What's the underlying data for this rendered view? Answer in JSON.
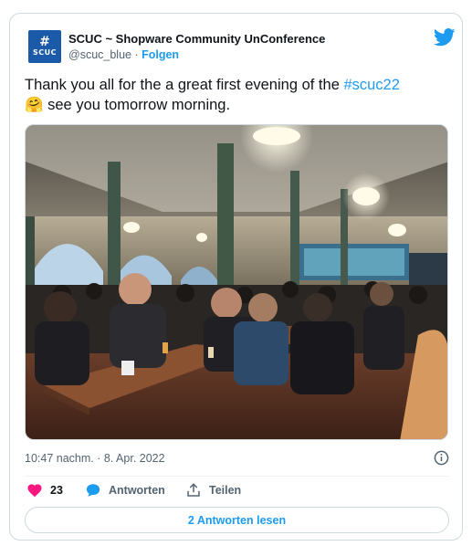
{
  "account": {
    "avatar_symbol": "#",
    "avatar_text": "SCUC",
    "display_name": "SCUC ~ Shopware Community UnConference",
    "handle": "@scuc_blue",
    "separator": " · ",
    "follow_label": "Folgen"
  },
  "tweet": {
    "text_before": "Thank you all for the a great first evening of the ",
    "hashtag": "#scuc22",
    "emoji": "🤗",
    "text_after": " see you tomorrow morning."
  },
  "meta": {
    "timestamp": "10:47 nachm. · 8. Apr. 2022"
  },
  "actions": {
    "like_count": "23",
    "reply_label": "Antworten",
    "share_label": "Teilen"
  },
  "read_replies_label": "2 Antworten lesen",
  "colors": {
    "accent": "#1d9bf0",
    "like": "#f91880",
    "text": "#0f1419",
    "muted": "#536471",
    "border": "#cfd9de",
    "avatar_bg": "#1a5aa8"
  },
  "icons": {
    "brand": "twitter-bird-icon",
    "like": "heart-icon",
    "reply": "speech-bubble-icon",
    "share": "share-upload-icon",
    "info": "info-icon"
  }
}
